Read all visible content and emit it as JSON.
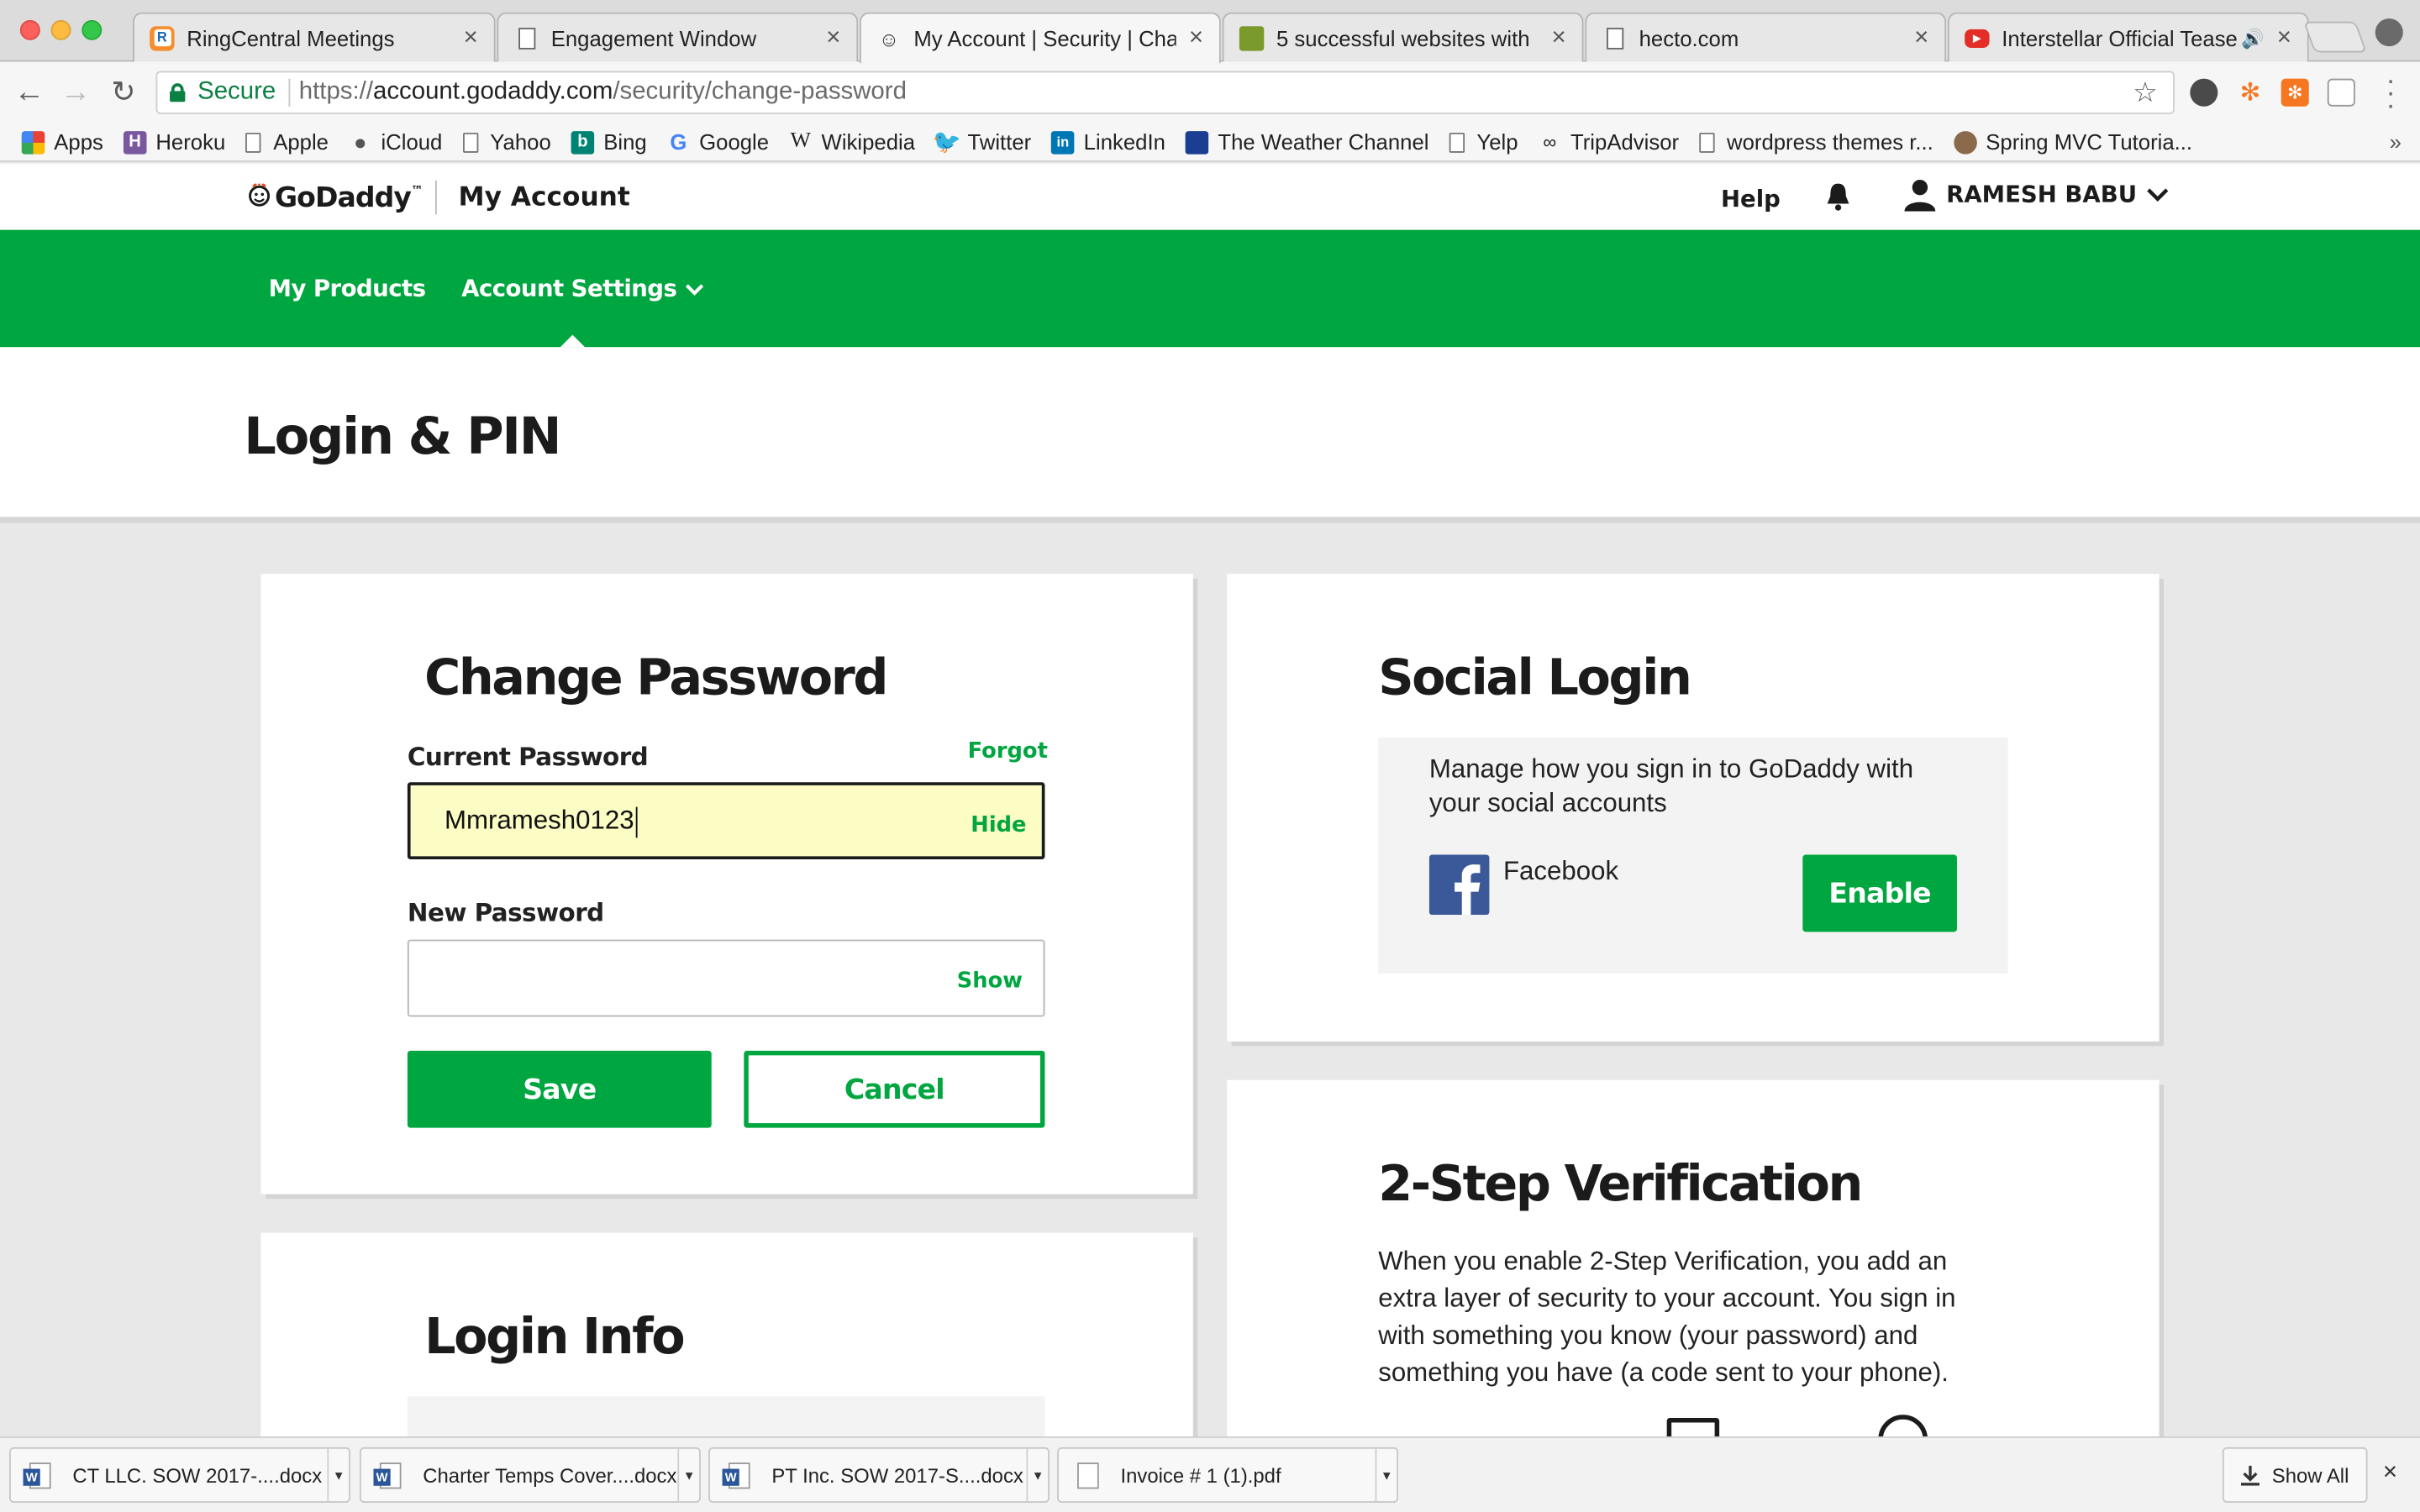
{
  "browser": {
    "tabs": [
      {
        "title": "RingCentral Meetings",
        "favicon": "ringcentral-icon"
      },
      {
        "title": "Engagement Window",
        "favicon": "page-icon"
      },
      {
        "title": "My Account | Security | Cha",
        "favicon": "godaddy-icon"
      },
      {
        "title": "5 successful websites with",
        "favicon": "site-icon"
      },
      {
        "title": "hecto.com",
        "favicon": "page-icon"
      },
      {
        "title": "Interstellar Official Tease",
        "favicon": "youtube-icon"
      }
    ],
    "close_glyph": "×",
    "secure_label": "Secure",
    "url": {
      "scheme": "https://",
      "host": "account.godaddy.com",
      "path": "/security/change-password"
    },
    "bookmarks": [
      {
        "label": "Apps",
        "icon": "apps-grid-icon"
      },
      {
        "label": "Heroku",
        "icon": "heroku-icon"
      },
      {
        "label": "Apple",
        "icon": "page-icon"
      },
      {
        "label": "iCloud",
        "icon": "apple-icon"
      },
      {
        "label": "Yahoo",
        "icon": "page-icon"
      },
      {
        "label": "Bing",
        "icon": "bing-icon"
      },
      {
        "label": "Google",
        "icon": "google-icon"
      },
      {
        "label": "Wikipedia",
        "icon": "wikipedia-icon"
      },
      {
        "label": "Twitter",
        "icon": "twitter-icon"
      },
      {
        "label": "LinkedIn",
        "icon": "linkedin-icon"
      },
      {
        "label": "The Weather Channel",
        "icon": "weather-channel-icon"
      },
      {
        "label": "Yelp",
        "icon": "page-icon"
      },
      {
        "label": "TripAdvisor",
        "icon": "tripadvisor-icon"
      },
      {
        "label": "wordpress themes r...",
        "icon": "page-icon"
      },
      {
        "label": "Spring MVC Tutoria...",
        "icon": "spring-icon"
      }
    ],
    "bookmarks_overflow": "»"
  },
  "header": {
    "logo": "GoDaddy",
    "logo_tm": "™",
    "my_account": "My Account",
    "help": "Help",
    "user_name": "RAMESH BABU"
  },
  "nav": {
    "my_products": "My Products",
    "account_settings": "Account Settings"
  },
  "page_title": "Login & PIN",
  "change_password": {
    "title": "Change Password",
    "current_label": "Current Password",
    "forgot": "Forgot",
    "current_value": "Mmramesh0123",
    "hide": "Hide",
    "new_label": "New Password",
    "new_value": "",
    "show": "Show",
    "save": "Save",
    "cancel": "Cancel"
  },
  "login_info": {
    "title": "Login Info"
  },
  "social_login": {
    "title": "Social Login",
    "description": "Manage how you sign in to GoDaddy with your social accounts",
    "provider": "Facebook",
    "enable": "Enable"
  },
  "two_step": {
    "title": "2-Step Verification",
    "description": "When you enable 2-Step Verification, you add an extra layer of security to your account. You sign in with something you know (your password) and something you have (a code sent to your phone)."
  },
  "downloads": {
    "items": [
      {
        "name": "CT LLC. SOW 2017-....docx",
        "type": "docx"
      },
      {
        "name": "Charter Temps Cover....docx",
        "type": "docx"
      },
      {
        "name": "PT Inc. SOW 2017-S....docx",
        "type": "docx"
      },
      {
        "name": "Invoice # 1 (1).pdf",
        "type": "pdf"
      }
    ],
    "show_all": "Show All",
    "close_glyph": "×"
  },
  "colors": {
    "brand_green": "#00a63f",
    "autofill_yellow": "#fbfdc4",
    "facebook_blue": "#3b5998"
  }
}
